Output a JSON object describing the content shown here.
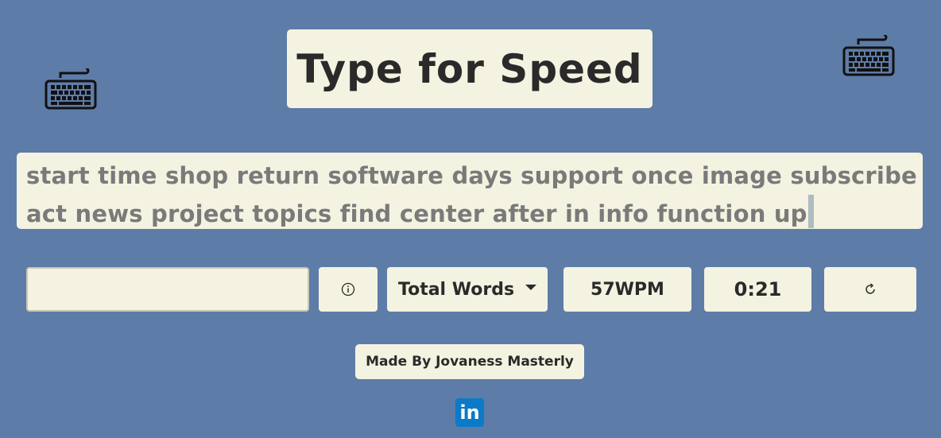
{
  "header": {
    "title": "Type for Speed",
    "left_icon": "keyboard-icon",
    "right_icon": "keyboard-icon"
  },
  "words_panel": {
    "line1": "start time shop return software days support once image subscribe",
    "line2": "act news project topics find center after in info function up"
  },
  "controls": {
    "typing_input_value": "",
    "info_icon": "info-icon",
    "mode_select": "Total Words",
    "wpm": "57WPM",
    "timer": "0:21",
    "reset_icon": "refresh-icon"
  },
  "footer": {
    "credit": "Made By Jovaness Masterly",
    "social_icon": "linkedin-icon",
    "social_text": "in"
  },
  "colors": {
    "background": "#5e7ca8",
    "panel": "#f4f3e1",
    "text": "#2a2a2a",
    "muted_text": "#7a7a7a",
    "linkedin": "#0a7ac9"
  }
}
